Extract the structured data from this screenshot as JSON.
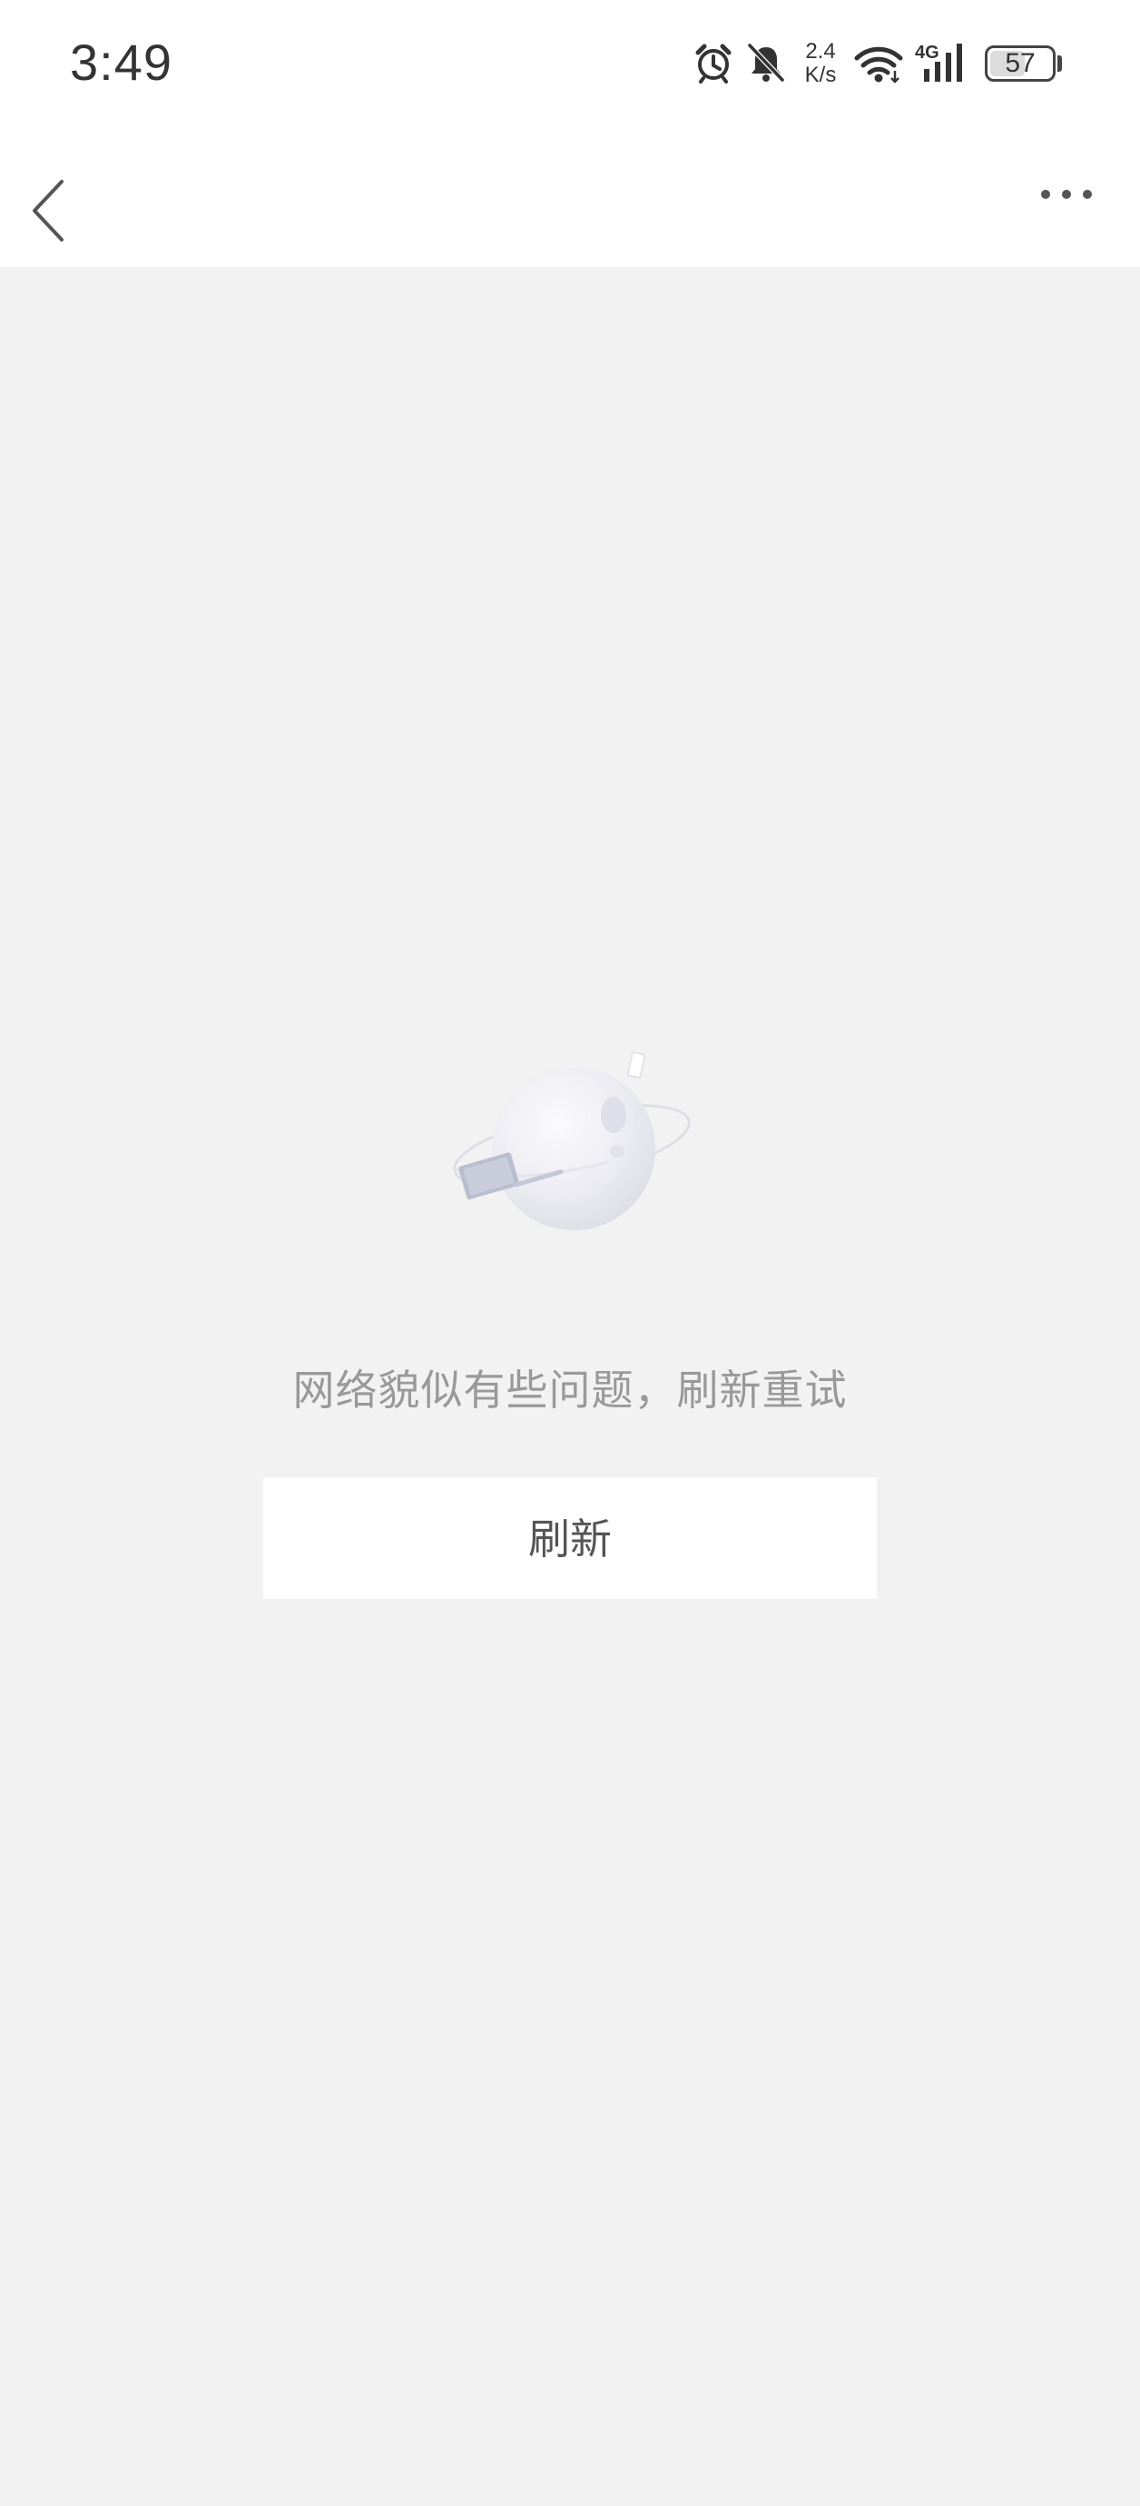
{
  "status_bar": {
    "time": "3:49",
    "network_speed": "2.4\nK/s",
    "network_speed_top": "2.4",
    "network_speed_bottom": "K/s",
    "network_type": "4G",
    "battery_level": "57",
    "battery_fraction": 0.57,
    "icons": [
      "alarm-icon",
      "bell-muted-icon",
      "wifi-icon",
      "cellular-signal-icon",
      "battery-icon"
    ]
  },
  "nav_bar": {
    "back_icon": "chevron-left-icon",
    "more_icon": "more-horizontal-icon"
  },
  "empty_state": {
    "illustration": "planet-illustration",
    "message": "网络貌似有些问题，刷新重试",
    "refresh_label": "刷新"
  },
  "colors": {
    "page_background": "#f2f2f2",
    "bar_background": "#ffffff",
    "message_text": "#999999",
    "button_text": "#555555"
  }
}
